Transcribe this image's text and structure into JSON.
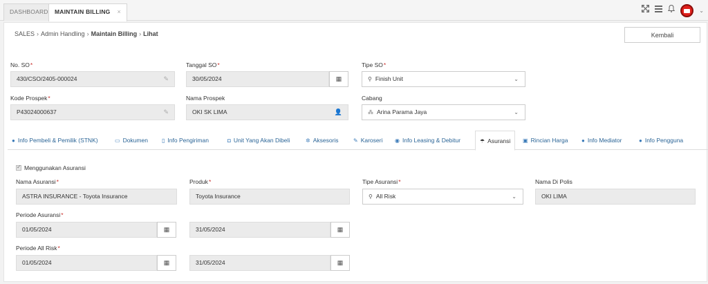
{
  "top_tabs": [
    {
      "label": "DASHBOARD"
    },
    {
      "label": "MAINTAIN BILLING",
      "close": "×"
    }
  ],
  "icons": {
    "expand": "fullscreen-icon",
    "menu": "menu-icon",
    "bell": "bell-icon",
    "avatar": "user-avatar",
    "caret": "chevron-down-icon"
  },
  "breadcrumb": {
    "items": [
      "SALES",
      "Admin Handling",
      "Maintain Billing",
      "Lihat"
    ]
  },
  "back_button": "Kembali",
  "header": {
    "no_so": {
      "label": "No. SO",
      "value": "430/CSO/2405-000024"
    },
    "tanggal_so": {
      "label": "Tanggal SO",
      "value": "30/05/2024"
    },
    "tipe_so": {
      "label": "Tipe SO",
      "value": "Finish Unit"
    },
    "kode_prospek": {
      "label": "Kode Prospek",
      "value": "P43024000637"
    },
    "nama_prospek": {
      "label": "Nama Prospek",
      "value": "OKI SK LIMA"
    },
    "cabang": {
      "label": "Cabang",
      "value": "Arina Parama Jaya"
    }
  },
  "section_tabs": [
    {
      "label": "Info Pembeli & Pemilik (STNK)",
      "icon": "user-icon"
    },
    {
      "label": "Dokumen",
      "icon": "folder-icon"
    },
    {
      "label": "Info Pengiriman",
      "icon": "map-icon"
    },
    {
      "label": "Unit Yang Akan Dibeli",
      "icon": "car-icon"
    },
    {
      "label": "Aksesoris",
      "icon": "gears-icon"
    },
    {
      "label": "Karoseri",
      "icon": "wrench-icon"
    },
    {
      "label": "Info Leasing & Debitur",
      "icon": "eye-icon"
    },
    {
      "label": "Asuransi",
      "icon": "umbrella-icon",
      "active": true
    },
    {
      "label": "Rincian Harga",
      "icon": "money-icon"
    },
    {
      "label": "Info Mediator",
      "icon": "users-icon"
    },
    {
      "label": "Info Pengguna",
      "icon": "user-icon"
    }
  ],
  "asuransi": {
    "checkbox_label": "Menggunakan Asuransi",
    "nama_asuransi": {
      "label": "Nama Asuransi",
      "value": "ASTRA INSURANCE - Toyota Insurance"
    },
    "produk": {
      "label": "Produk",
      "value": "Toyota Insurance"
    },
    "tipe_asuransi": {
      "label": "Tipe Asuransi",
      "value": "All Risk"
    },
    "nama_di_polis": {
      "label": "Nama Di Polis",
      "value": "OKI LIMA"
    },
    "periode_asuransi": {
      "label": "Periode Asuransi",
      "start": "01/05/2024",
      "end": "31/05/2024"
    },
    "periode_all_risk": {
      "label": "Periode All Risk",
      "start": "01/05/2024",
      "end": "31/05/2024"
    }
  },
  "required_marker": "*"
}
